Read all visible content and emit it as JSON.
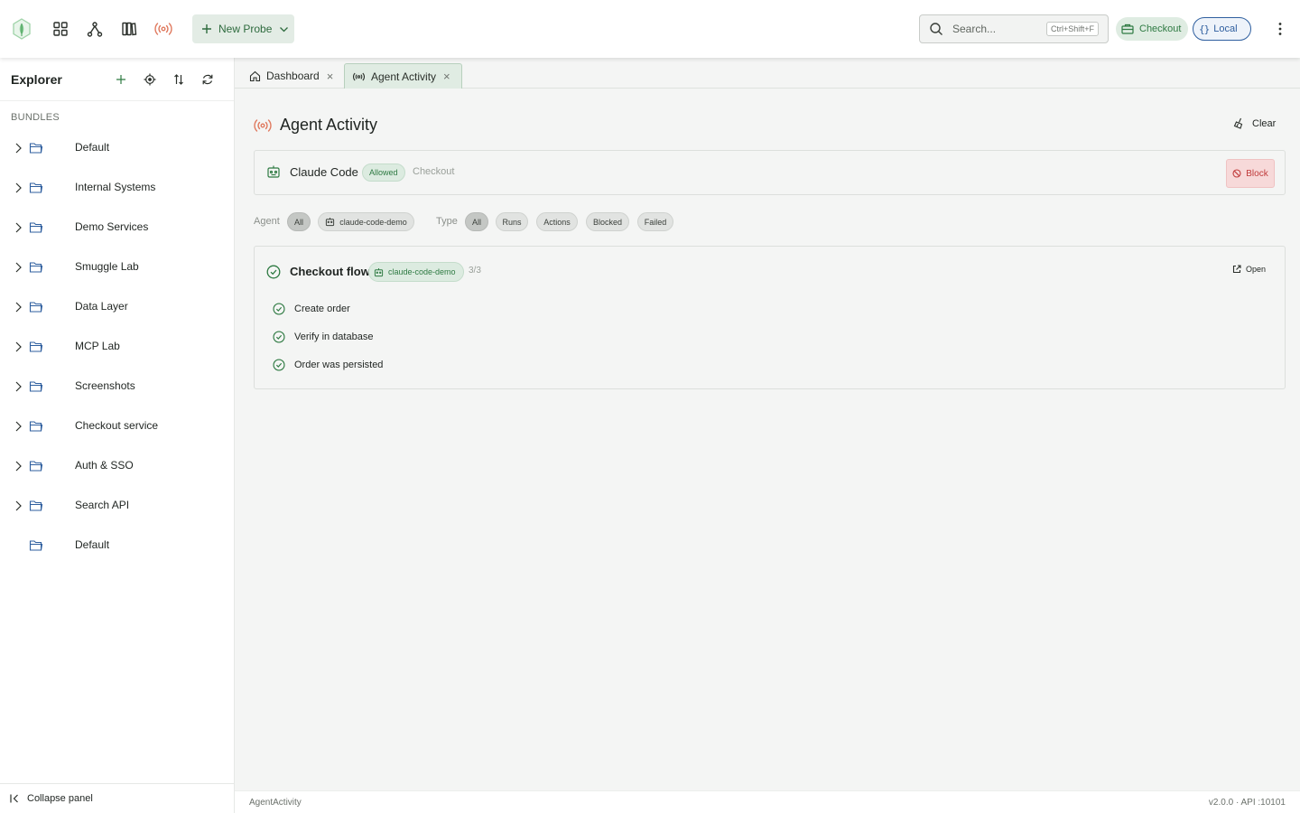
{
  "toolbar": {
    "new_probe_label": "New Probe",
    "search_placeholder": "Search...",
    "search_shortcut": "Ctrl+Shift+F",
    "bundle_chip": "Checkout",
    "env_chip": "Local",
    "env_chip_brace": "{}"
  },
  "sidebar": {
    "title": "Explorer",
    "section_label": "BUNDLES",
    "items": [
      {
        "label": "Default",
        "expandable": true
      },
      {
        "label": "Internal Systems",
        "expandable": true
      },
      {
        "label": "Demo Services",
        "expandable": true
      },
      {
        "label": "Smuggle Lab",
        "expandable": true
      },
      {
        "label": "Data Layer",
        "expandable": true
      },
      {
        "label": "MCP Lab",
        "expandable": true
      },
      {
        "label": "Screenshots",
        "expandable": true
      },
      {
        "label": "Checkout service",
        "expandable": true
      },
      {
        "label": "Auth & SSO",
        "expandable": true
      },
      {
        "label": "Search API",
        "expandable": true
      },
      {
        "label": "Default",
        "expandable": false
      }
    ],
    "collapse_label": "Collapse panel"
  },
  "tabs": [
    {
      "label": "Dashboard",
      "active": false
    },
    {
      "label": "Agent Activity",
      "active": true
    }
  ],
  "page": {
    "title": "Agent Activity",
    "clear_label": "Clear"
  },
  "agent": {
    "name": "Claude Code",
    "status": "Allowed",
    "bundle": "Checkout",
    "block_label": "Block"
  },
  "filters": {
    "agent_label": "Agent",
    "agent_options": [
      "All",
      "claude-code-demo"
    ],
    "agent_selected": "All",
    "type_label": "Type",
    "type_options": [
      "All",
      "Runs",
      "Actions",
      "Blocked",
      "Failed"
    ],
    "type_selected": "All"
  },
  "run": {
    "name": "Checkout flow",
    "agent": "claude-code-demo",
    "count": "3/3",
    "open_label": "Open",
    "steps": [
      {
        "label": "Create order",
        "status": "passed"
      },
      {
        "label": "Verify in database",
        "status": "passed"
      },
      {
        "label": "Order was persisted",
        "status": "passed"
      }
    ]
  },
  "status_bar": {
    "view": "AgentActivity",
    "version": "v2.0.0",
    "api": " · API :10101"
  },
  "colors": {
    "accent_green": "#2e7a42",
    "live_orange": "#e07a5f",
    "block_red": "#c03a3a",
    "env_blue": "#2f5f9f"
  }
}
